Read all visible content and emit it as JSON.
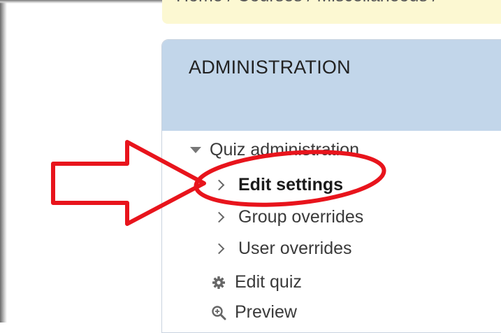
{
  "breadcrumb": {
    "text": "Home / Courses / Miscellaneous /"
  },
  "administration": {
    "title": "ADMINISTRATION",
    "section": {
      "label": "Quiz administration",
      "icon": "caret-down-icon"
    },
    "items": [
      {
        "label": "Edit settings",
        "icon": "chevron-right-icon"
      },
      {
        "label": "Group overrides",
        "icon": "chevron-right-icon"
      },
      {
        "label": "User overrides",
        "icon": "chevron-right-icon"
      },
      {
        "label": "Edit quiz",
        "icon": "gear-icon"
      },
      {
        "label": "Preview",
        "icon": "magnifier-plus-icon"
      }
    ]
  },
  "colors": {
    "header_bg": "#c2d6ea",
    "breadcrumb_bg": "#fcf8d2",
    "annotation_red": "#e8141c"
  }
}
